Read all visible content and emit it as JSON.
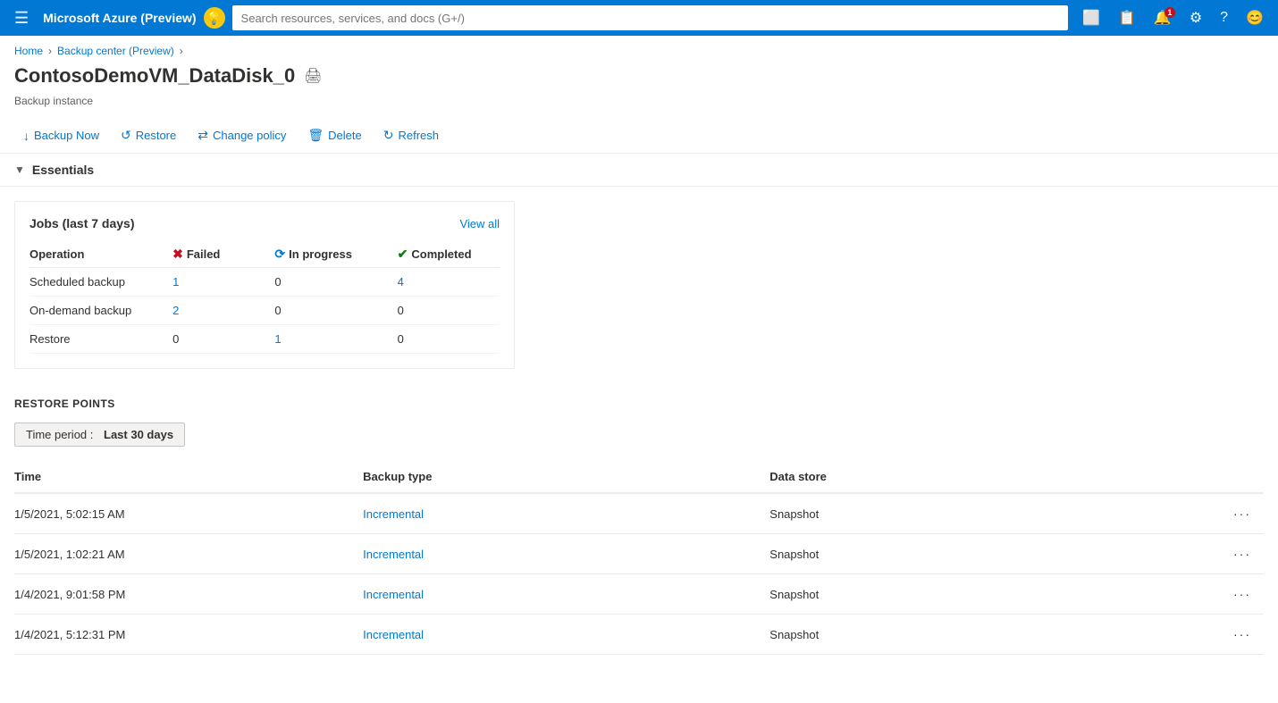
{
  "topbar": {
    "title": "Microsoft Azure (Preview)",
    "search_placeholder": "Search resources, services, and docs (G+/)",
    "notification_count": "1"
  },
  "breadcrumb": {
    "home": "Home",
    "parent": "Backup center (Preview)"
  },
  "page": {
    "title": "ContosoDemoVM_DataDisk_0",
    "subtitle": "Backup instance",
    "print_icon": "🖨"
  },
  "toolbar": {
    "backup_now": "Backup Now",
    "restore": "Restore",
    "change_policy": "Change policy",
    "delete": "Delete",
    "refresh": "Refresh"
  },
  "essentials": {
    "label": "Essentials"
  },
  "jobs_card": {
    "title": "Jobs (last 7 days)",
    "view_all": "View all",
    "columns": {
      "operation": "Operation",
      "failed": "Failed",
      "in_progress": "In progress",
      "completed": "Completed"
    },
    "rows": [
      {
        "operation": "Scheduled backup",
        "failed": "1",
        "in_progress": "0",
        "completed": "4",
        "failed_link": true,
        "progress_link": false,
        "completed_link": true
      },
      {
        "operation": "On-demand backup",
        "failed": "2",
        "in_progress": "0",
        "completed": "0",
        "failed_link": true,
        "progress_link": false,
        "completed_link": false
      },
      {
        "operation": "Restore",
        "failed": "0",
        "in_progress": "1",
        "completed": "0",
        "failed_link": false,
        "progress_link": true,
        "completed_link": false
      }
    ]
  },
  "restore_points": {
    "section_title": "RESTORE POINTS",
    "time_period_label": "Time period :",
    "time_period_value": "Last 30 days",
    "columns": {
      "time": "Time",
      "backup_type": "Backup type",
      "data_store": "Data store"
    },
    "rows": [
      {
        "time": "1/5/2021, 5:02:15 AM",
        "backup_type": "Incremental",
        "data_store": "Snapshot"
      },
      {
        "time": "1/5/2021, 1:02:21 AM",
        "backup_type": "Incremental",
        "data_store": "Snapshot"
      },
      {
        "time": "1/4/2021, 9:01:58 PM",
        "backup_type": "Incremental",
        "data_store": "Snapshot"
      },
      {
        "time": "1/4/2021, 5:12:31 PM",
        "backup_type": "Incremental",
        "data_store": "Snapshot"
      }
    ]
  }
}
